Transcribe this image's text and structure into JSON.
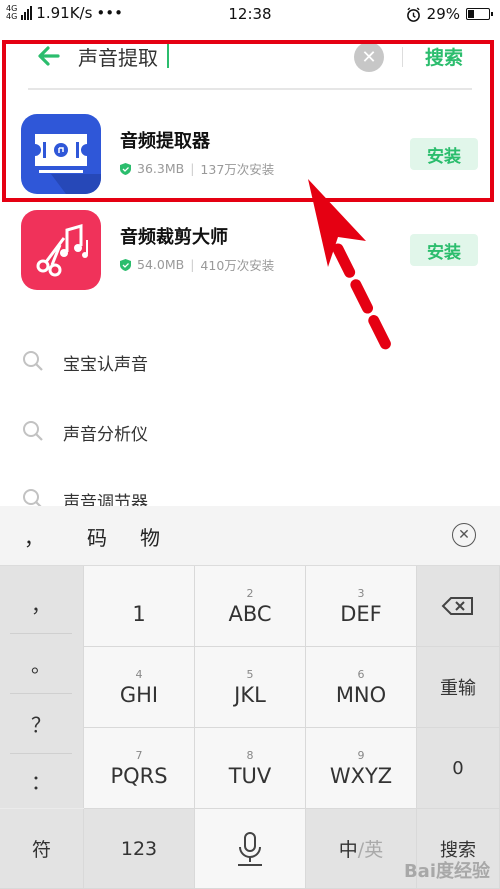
{
  "status_bar": {
    "network": "4G",
    "network2": "4G",
    "speed": "1.91K/s",
    "dots": "•••",
    "time": "12:38",
    "battery": "29%",
    "battery_level": 0.29
  },
  "search": {
    "query": "声音提取",
    "clear_symbol": "✕",
    "search_label": "搜索"
  },
  "apps": [
    {
      "name": "音频提取器",
      "size": "36.3MB",
      "installs": "137万次安装",
      "install_label": "安装"
    },
    {
      "name": "音频裁剪大师",
      "size": "54.0MB",
      "installs": "410万次安装",
      "install_label": "安装"
    }
  ],
  "suggestions": [
    "宝宝认声音",
    "声音分析仪",
    "声音调节器"
  ],
  "keyboard": {
    "candidates": [
      "，",
      "码",
      "物"
    ],
    "side_keys": [
      "，",
      "。",
      "？",
      "："
    ],
    "keys": {
      "k1": {
        "num": "",
        "label": "1"
      },
      "k2": {
        "num": "2",
        "label": "ABC"
      },
      "k3": {
        "num": "3",
        "label": "DEF"
      },
      "k4": {
        "num": "4",
        "label": "GHI"
      },
      "k5": {
        "num": "5",
        "label": "JKL"
      },
      "k6": {
        "num": "6",
        "label": "MNO"
      },
      "k7": {
        "num": "7",
        "label": "PQRS"
      },
      "k8": {
        "num": "8",
        "label": "TUV"
      },
      "k9": {
        "num": "9",
        "label": "WXYZ"
      }
    },
    "reinput_label": "重输",
    "zero_label": "0",
    "symbol_label": "符",
    "num_label": "123",
    "lang_zh": "中",
    "lang_en": "/英",
    "search_label": "搜索"
  },
  "watermark": "Bai度经验",
  "colors": {
    "accent": "#2bbd6d",
    "highlight": "#e50012",
    "app1_icon": "#2f57d8",
    "app2_icon": "#f0325a"
  }
}
